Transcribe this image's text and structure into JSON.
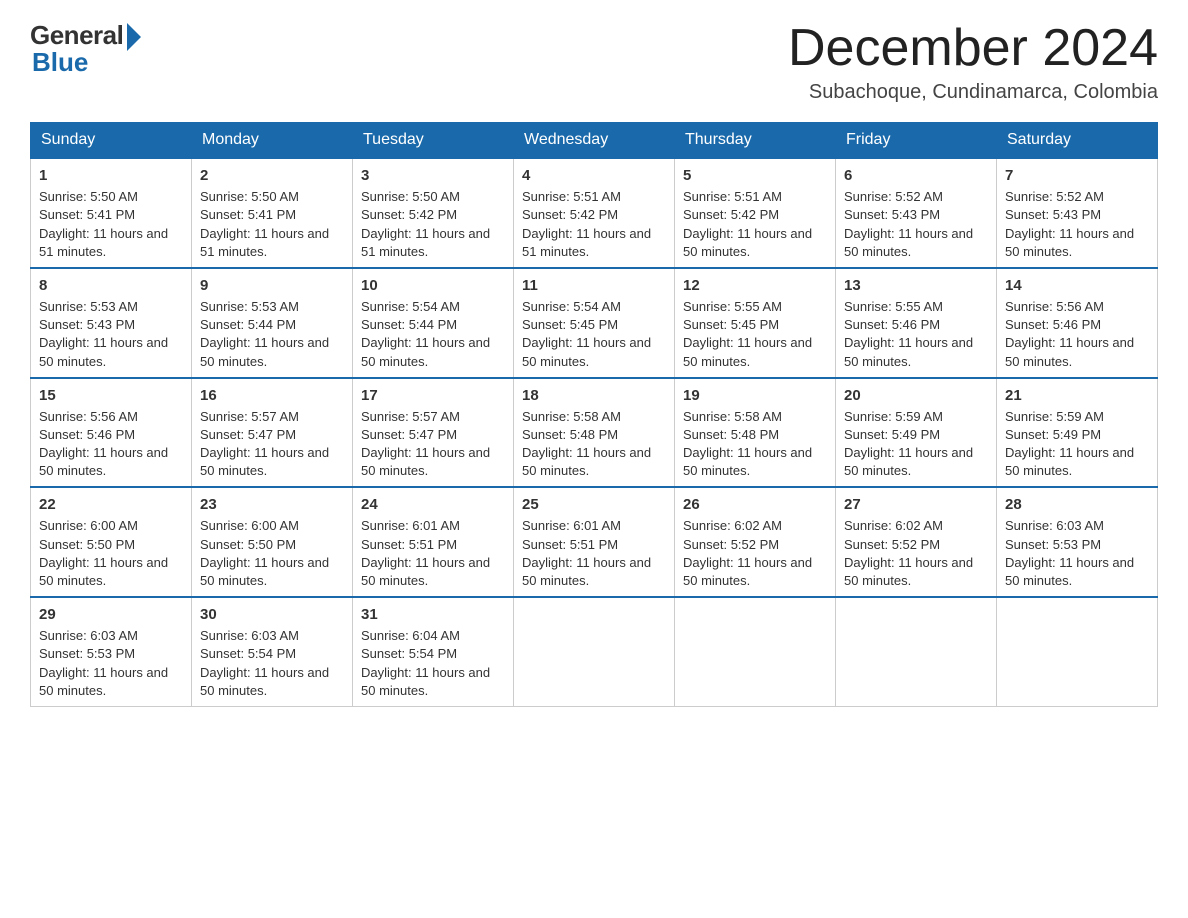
{
  "logo": {
    "general": "General",
    "blue": "Blue"
  },
  "header": {
    "month": "December 2024",
    "location": "Subachoque, Cundinamarca, Colombia"
  },
  "days": [
    "Sunday",
    "Monday",
    "Tuesday",
    "Wednesday",
    "Thursday",
    "Friday",
    "Saturday"
  ],
  "weeks": [
    [
      {
        "day": 1,
        "sunrise": "5:50 AM",
        "sunset": "5:41 PM",
        "daylight": "11 hours and 51 minutes."
      },
      {
        "day": 2,
        "sunrise": "5:50 AM",
        "sunset": "5:41 PM",
        "daylight": "11 hours and 51 minutes."
      },
      {
        "day": 3,
        "sunrise": "5:50 AM",
        "sunset": "5:42 PM",
        "daylight": "11 hours and 51 minutes."
      },
      {
        "day": 4,
        "sunrise": "5:51 AM",
        "sunset": "5:42 PM",
        "daylight": "11 hours and 51 minutes."
      },
      {
        "day": 5,
        "sunrise": "5:51 AM",
        "sunset": "5:42 PM",
        "daylight": "11 hours and 50 minutes."
      },
      {
        "day": 6,
        "sunrise": "5:52 AM",
        "sunset": "5:43 PM",
        "daylight": "11 hours and 50 minutes."
      },
      {
        "day": 7,
        "sunrise": "5:52 AM",
        "sunset": "5:43 PM",
        "daylight": "11 hours and 50 minutes."
      }
    ],
    [
      {
        "day": 8,
        "sunrise": "5:53 AM",
        "sunset": "5:43 PM",
        "daylight": "11 hours and 50 minutes."
      },
      {
        "day": 9,
        "sunrise": "5:53 AM",
        "sunset": "5:44 PM",
        "daylight": "11 hours and 50 minutes."
      },
      {
        "day": 10,
        "sunrise": "5:54 AM",
        "sunset": "5:44 PM",
        "daylight": "11 hours and 50 minutes."
      },
      {
        "day": 11,
        "sunrise": "5:54 AM",
        "sunset": "5:45 PM",
        "daylight": "11 hours and 50 minutes."
      },
      {
        "day": 12,
        "sunrise": "5:55 AM",
        "sunset": "5:45 PM",
        "daylight": "11 hours and 50 minutes."
      },
      {
        "day": 13,
        "sunrise": "5:55 AM",
        "sunset": "5:46 PM",
        "daylight": "11 hours and 50 minutes."
      },
      {
        "day": 14,
        "sunrise": "5:56 AM",
        "sunset": "5:46 PM",
        "daylight": "11 hours and 50 minutes."
      }
    ],
    [
      {
        "day": 15,
        "sunrise": "5:56 AM",
        "sunset": "5:46 PM",
        "daylight": "11 hours and 50 minutes."
      },
      {
        "day": 16,
        "sunrise": "5:57 AM",
        "sunset": "5:47 PM",
        "daylight": "11 hours and 50 minutes."
      },
      {
        "day": 17,
        "sunrise": "5:57 AM",
        "sunset": "5:47 PM",
        "daylight": "11 hours and 50 minutes."
      },
      {
        "day": 18,
        "sunrise": "5:58 AM",
        "sunset": "5:48 PM",
        "daylight": "11 hours and 50 minutes."
      },
      {
        "day": 19,
        "sunrise": "5:58 AM",
        "sunset": "5:48 PM",
        "daylight": "11 hours and 50 minutes."
      },
      {
        "day": 20,
        "sunrise": "5:59 AM",
        "sunset": "5:49 PM",
        "daylight": "11 hours and 50 minutes."
      },
      {
        "day": 21,
        "sunrise": "5:59 AM",
        "sunset": "5:49 PM",
        "daylight": "11 hours and 50 minutes."
      }
    ],
    [
      {
        "day": 22,
        "sunrise": "6:00 AM",
        "sunset": "5:50 PM",
        "daylight": "11 hours and 50 minutes."
      },
      {
        "day": 23,
        "sunrise": "6:00 AM",
        "sunset": "5:50 PM",
        "daylight": "11 hours and 50 minutes."
      },
      {
        "day": 24,
        "sunrise": "6:01 AM",
        "sunset": "5:51 PM",
        "daylight": "11 hours and 50 minutes."
      },
      {
        "day": 25,
        "sunrise": "6:01 AM",
        "sunset": "5:51 PM",
        "daylight": "11 hours and 50 minutes."
      },
      {
        "day": 26,
        "sunrise": "6:02 AM",
        "sunset": "5:52 PM",
        "daylight": "11 hours and 50 minutes."
      },
      {
        "day": 27,
        "sunrise": "6:02 AM",
        "sunset": "5:52 PM",
        "daylight": "11 hours and 50 minutes."
      },
      {
        "day": 28,
        "sunrise": "6:03 AM",
        "sunset": "5:53 PM",
        "daylight": "11 hours and 50 minutes."
      }
    ],
    [
      {
        "day": 29,
        "sunrise": "6:03 AM",
        "sunset": "5:53 PM",
        "daylight": "11 hours and 50 minutes."
      },
      {
        "day": 30,
        "sunrise": "6:03 AM",
        "sunset": "5:54 PM",
        "daylight": "11 hours and 50 minutes."
      },
      {
        "day": 31,
        "sunrise": "6:04 AM",
        "sunset": "5:54 PM",
        "daylight": "11 hours and 50 minutes."
      },
      null,
      null,
      null,
      null
    ]
  ],
  "labels": {
    "sunrise": "Sunrise:",
    "sunset": "Sunset:",
    "daylight": "Daylight:"
  }
}
